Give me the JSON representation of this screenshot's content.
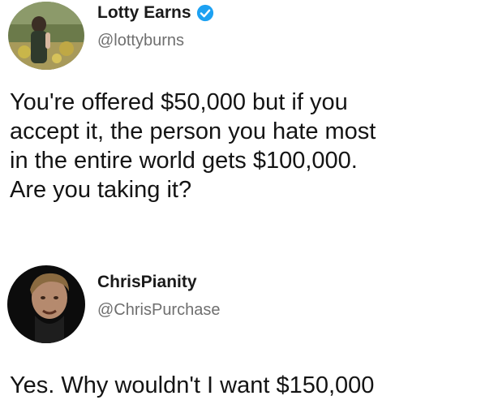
{
  "tweets": [
    {
      "display_name": "Lotty Earns",
      "handle": "@lottyburns",
      "verified": true,
      "avatar_icon": "profile-photo-outdoor-person",
      "text_lines": [
        "You're offered $50,000 but if you",
        "accept it, the person you hate most",
        "in the entire world gets $100,000.",
        "Are you taking it?"
      ]
    },
    {
      "display_name": "ChrisPianity",
      "handle": "@ChrisPurchase",
      "verified": false,
      "avatar_icon": "profile-photo-face",
      "text": "Yes. Why wouldn't I want $150,000"
    }
  ],
  "colors": {
    "verified_badge": "#1da1f2",
    "handle_text": "#6f6f6f",
    "body_text": "#141414"
  }
}
